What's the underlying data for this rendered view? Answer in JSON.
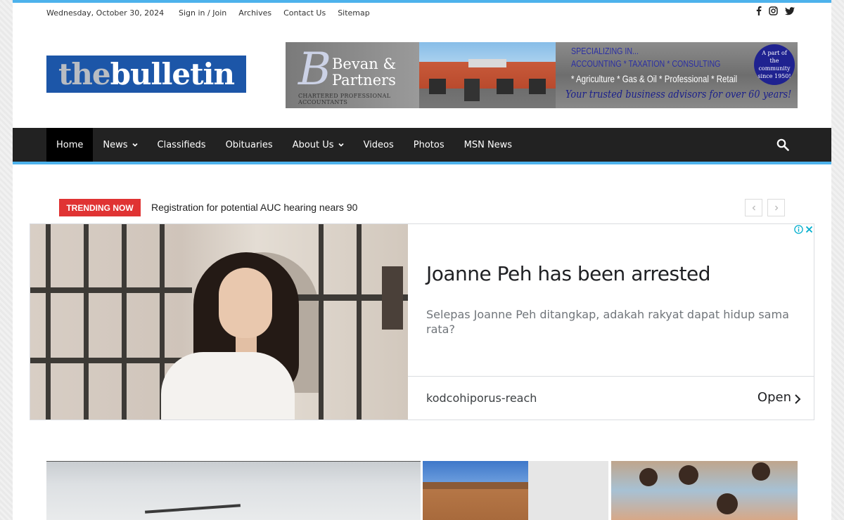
{
  "topbar": {
    "date": "Wednesday, October 30, 2024",
    "links": [
      "Sign in / Join",
      "Archives",
      "Contact Us",
      "Sitemap"
    ],
    "social": [
      "facebook-icon",
      "instagram-icon",
      "twitter-icon"
    ]
  },
  "logo": {
    "part1": "the",
    "part2": "bulletin"
  },
  "banner_ad": {
    "letter": "B",
    "firm_line1": "Bevan &",
    "firm_line2": "Partners",
    "firm_sub": "CHARTERED PROFESSIONAL ACCOUNTANTS",
    "line1": "SPECIALIZING IN...",
    "line2": "ACCOUNTING * TAXATION * CONSULTING",
    "line3": "* Agriculture * Gas & Oil * Professional * Retail",
    "line4": "Your trusted business advisors for over 60 years!",
    "badge_line1": "A part of",
    "badge_line2": "the community",
    "badge_line3": "since 1950!"
  },
  "nav": {
    "items": [
      {
        "label": "Home",
        "active": true,
        "dropdown": false
      },
      {
        "label": "News",
        "active": false,
        "dropdown": true
      },
      {
        "label": "Classifieds",
        "active": false,
        "dropdown": false
      },
      {
        "label": "Obituaries",
        "active": false,
        "dropdown": false
      },
      {
        "label": "About Us",
        "active": false,
        "dropdown": true
      },
      {
        "label": "Videos",
        "active": false,
        "dropdown": false
      },
      {
        "label": "Photos",
        "active": false,
        "dropdown": false
      },
      {
        "label": "MSN News",
        "active": false,
        "dropdown": false
      }
    ]
  },
  "trending": {
    "label": "TRENDING NOW",
    "headline": "Registration for potential AUC hearing nears 90"
  },
  "native_ad": {
    "headline": "Joanne Peh has been arrested",
    "description": "Selepas Joanne Peh ditangkap, adakah rakyat dapat hidup sama rata?",
    "domain": "kodcohiporus-reach",
    "cta": "Open"
  },
  "colors": {
    "accent": "#4db2ec",
    "nav_bg": "#222222",
    "trending_red": "#e03333",
    "logo_blue": "#1c56a8"
  }
}
